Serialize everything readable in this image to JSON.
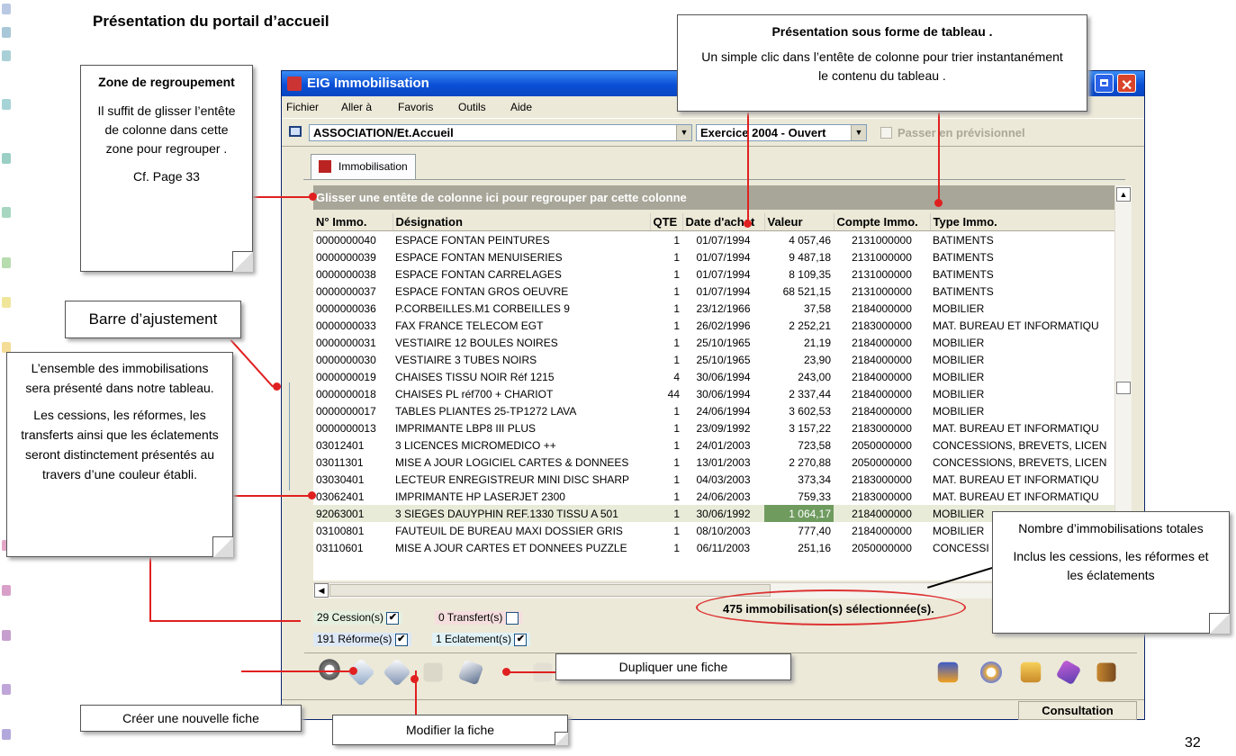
{
  "slide": {
    "title": "Présentation du portail d’accueil",
    "page_number": "32"
  },
  "window": {
    "title": "EIG Immobilisation",
    "menu": [
      "Fichier",
      "Aller à",
      "Favoris",
      "Outils",
      "Aide"
    ],
    "association_combo": "ASSOCIATION/Et.Accueil",
    "exercice_combo": "Exercice 2004 - Ouvert",
    "previsionnel_label": "Passer en prévisionnel",
    "tab_label": "Immobilisation",
    "group_bar": "Glisser une entête de colonne ici pour regrouper par cette colonne",
    "columns": [
      "N° Immo.",
      "Désignation",
      "QTE",
      "Date d'achat",
      "Valeur",
      "Compte Immo.",
      "Type Immo."
    ],
    "rows": [
      [
        "0000000040",
        "ESPACE FONTAN PEINTURES",
        "1",
        "01/07/1994",
        "4 057,46",
        "2131000000",
        "BATIMENTS"
      ],
      [
        "0000000039",
        "ESPACE FONTAN MENUISERIES",
        "1",
        "01/07/1994",
        "9 487,18",
        "2131000000",
        "BATIMENTS"
      ],
      [
        "0000000038",
        "ESPACE FONTAN CARRELAGES",
        "1",
        "01/07/1994",
        "8 109,35",
        "2131000000",
        "BATIMENTS"
      ],
      [
        "0000000037",
        "ESPACE FONTAN GROS OEUVRE",
        "1",
        "01/07/1994",
        "68 521,15",
        "2131000000",
        "BATIMENTS"
      ],
      [
        "0000000036",
        "P.CORBEILLES.M1 CORBEILLES 9",
        "1",
        "23/12/1966",
        "37,58",
        "2184000000",
        "MOBILIER"
      ],
      [
        "0000000033",
        "FAX FRANCE TELECOM EGT",
        "1",
        "26/02/1996",
        "2 252,21",
        "2183000000",
        "MAT. BUREAU ET INFORMATIQU"
      ],
      [
        "0000000031",
        "VESTIAIRE 12 BOULES NOIRES",
        "1",
        "25/10/1965",
        "21,19",
        "2184000000",
        "MOBILIER"
      ],
      [
        "0000000030",
        "VESTIAIRE 3 TUBES NOIRS",
        "1",
        "25/10/1965",
        "23,90",
        "2184000000",
        "MOBILIER"
      ],
      [
        "0000000019",
        "CHAISES TISSU NOIR Réf 1215",
        "4",
        "30/06/1994",
        "243,00",
        "2184000000",
        "MOBILIER"
      ],
      [
        "0000000018",
        "CHAISES PL réf700 + CHARIOT",
        "44",
        "30/06/1994",
        "2 337,44",
        "2184000000",
        "MOBILIER"
      ],
      [
        "0000000017",
        "TABLES PLIANTES 25-TP1272 LAVA",
        "1",
        "24/06/1994",
        "3 602,53",
        "2184000000",
        "MOBILIER"
      ],
      [
        "0000000013",
        "IMPRIMANTE LBP8 III PLUS",
        "1",
        "23/09/1992",
        "3 157,22",
        "2183000000",
        "MAT. BUREAU ET INFORMATIQU"
      ],
      [
        "03012401",
        "3 LICENCES MICROMEDICO ++",
        "1",
        "24/01/2003",
        "723,58",
        "2050000000",
        "CONCESSIONS, BREVETS, LICEN"
      ],
      [
        "03011301",
        "MISE A JOUR LOGICIEL  CARTES & DONNEES",
        "1",
        "13/01/2003",
        "2 270,88",
        "2050000000",
        "CONCESSIONS, BREVETS, LICEN"
      ],
      [
        "03030401",
        "LECTEUR ENREGISTREUR MINI DISC SHARP",
        "1",
        "04/03/2003",
        "373,34",
        "2183000000",
        "MAT. BUREAU ET INFORMATIQU"
      ],
      [
        "03062401",
        "IMPRIMANTE HP LASERJET 2300",
        "1",
        "24/06/2003",
        "759,33",
        "2183000000",
        "MAT. BUREAU ET INFORMATIQU"
      ],
      [
        "92063001",
        "3 SIEGES DAUYPHIN REF.1330 TISSU A 501",
        "1",
        "30/06/1992",
        "1 064,17",
        "2184000000",
        "MOBILIER"
      ],
      [
        "03100801",
        "FAUTEUIL DE BUREAU MAXI DOSSIER GRIS",
        "1",
        "08/10/2003",
        "777,40",
        "2184000000",
        "MOBILIER"
      ],
      [
        "03110601",
        "MISE A JOUR CARTES ET DONNEES PUZZLE",
        "1",
        "06/11/2003",
        "251,16",
        "2050000000",
        "CONCESSI"
      ]
    ],
    "legend": {
      "cession": "29 Cession(s)",
      "transfert": "0 Transfert(s)",
      "reforme": "191 Réforme(s)",
      "eclatement": "1 Eclatement(s)"
    },
    "selection_count": "475 immobilisation(s) sélectionnée(s).",
    "status": "Consultation"
  },
  "callouts": {
    "regroupement": {
      "title": "Zone de regroupement",
      "body": "Il suffit de glisser l’entête de colonne dans cette zone pour regrouper .",
      "ref": "Cf. Page 33"
    },
    "tableau": {
      "title": "Présentation sous forme de tableau .",
      "body": "Un simple clic dans l’entête de colonne pour trier instantanément le contenu du tableau ."
    },
    "barre": "Barre d’ajustement",
    "ensemble": {
      "p1": "L’ensemble des immobilisations sera présenté dans notre tableau.",
      "p2": "Les cessions, les réformes, les transferts ainsi que les éclatements seront distinctement présentés au travers d’une couleur établi."
    },
    "nombre": {
      "p1": "Nombre d’immobilisations totales",
      "p2": "Inclus les cessions, les réformes et les éclatements"
    },
    "dupliquer": "Dupliquer une fiche",
    "creer": "Créer une nouvelle fiche",
    "modifier": "Modifier la fiche"
  },
  "colors": {
    "titlebar": "#0a4fd6",
    "group_bar": "#a8a698",
    "highlight_cell": "#6f9b5f",
    "callout_line": "#e02020",
    "cession": "#e6f0e0",
    "transfert": "#f6dede",
    "reforme": "#dde8f6",
    "eclatement": "#e0f2f6"
  }
}
